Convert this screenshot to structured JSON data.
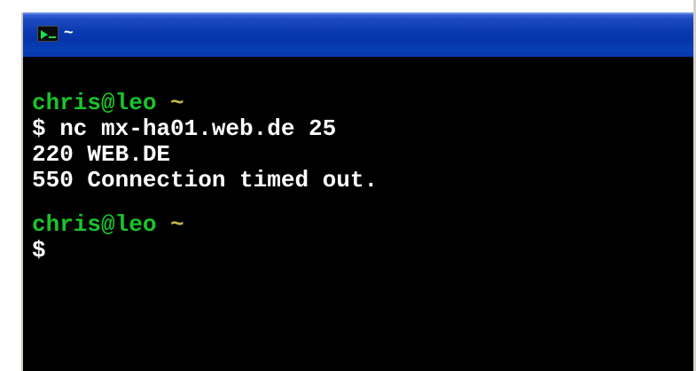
{
  "window": {
    "title": "~",
    "icon": "console-icon"
  },
  "console": {
    "block1": {
      "prompt_user": "chris@leo",
      "prompt_path": "~",
      "command_line": "$ nc mx-ha01.web.de 25",
      "output_1": "220 WEB.DE",
      "output_2": "550 Connection timed out."
    },
    "block2": {
      "prompt_user": "chris@leo",
      "prompt_path": "~",
      "command_line": "$"
    }
  },
  "colors": {
    "prompt_user": "#19c52a",
    "prompt_path": "#c8b64a",
    "text": "#ffffff",
    "background": "#000000",
    "titlebar": "#0a3ab1"
  }
}
